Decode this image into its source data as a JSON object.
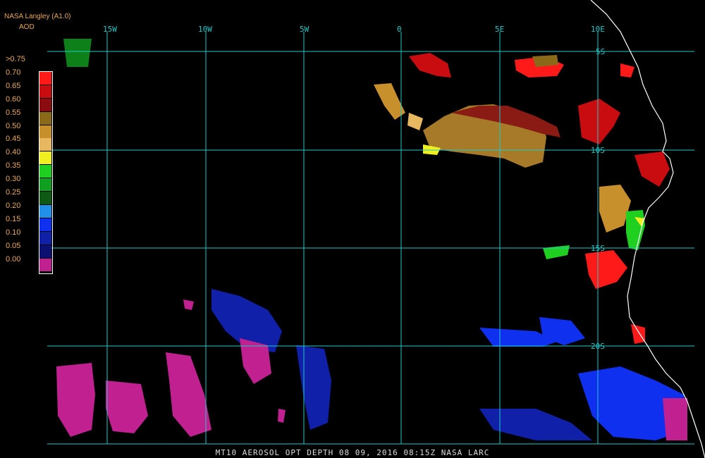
{
  "header": {
    "title": "NASA Langley (A1.0)",
    "unit": "AOD"
  },
  "legend": [
    {
      "label": ">0.75",
      "color": ""
    },
    {
      "label": "0.70",
      "color": "#ff1a1a"
    },
    {
      "label": "0.65",
      "color": "#c80c10"
    },
    {
      "label": "0.60",
      "color": "#8a0c10"
    },
    {
      "label": "0.55",
      "color": "#8a6a18"
    },
    {
      "label": "0.50",
      "color": "#c8902c"
    },
    {
      "label": "0.45",
      "color": "#e8b860"
    },
    {
      "label": "0.40",
      "color": "#f0f020"
    },
    {
      "label": "0.35",
      "color": "#20d020"
    },
    {
      "label": "0.30",
      "color": "#10a020"
    },
    {
      "label": "0.25",
      "color": "#0e5a14"
    },
    {
      "label": "0.20",
      "color": "#2090e8"
    },
    {
      "label": "0.15",
      "color": "#1030f0"
    },
    {
      "label": "0.10",
      "color": "#1020a8"
    },
    {
      "label": "0.05",
      "color": "#0c1070"
    },
    {
      "label": "0.00",
      "color": "#c02090"
    }
  ],
  "longitudes": [
    "15W",
    "10W",
    "5W",
    "0",
    "5E",
    "10E"
  ],
  "latitudes": [
    "5S",
    "10S",
    "15S",
    "20S"
  ],
  "footer": "MT10  AEROSOL OPT DEPTH   08 09, 2016 08:15Z   NASA LARC",
  "colors": {
    "grid": "#20c8c8",
    "coast": "#ffffff",
    "label": "#e8a85a"
  }
}
